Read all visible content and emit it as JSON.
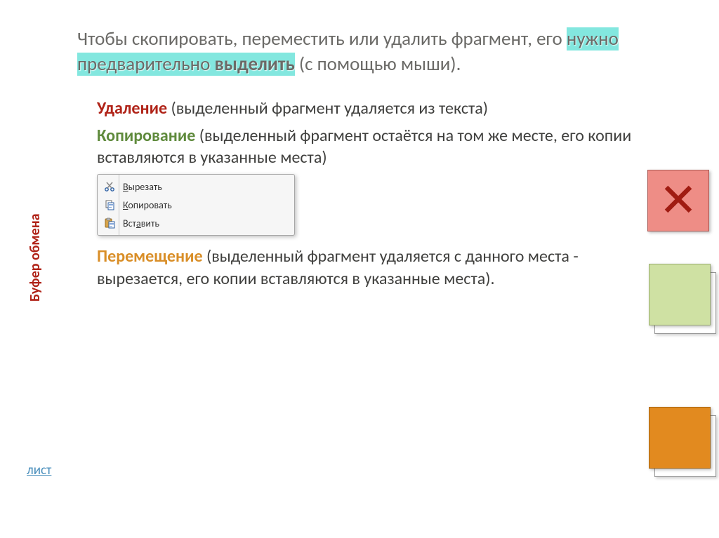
{
  "title": {
    "part1": "Чтобы скопировать, переместить или удалить фрагмент, его ",
    "highlight_pre": "нужно предварительно ",
    "highlight_bold": "выделить",
    "part2": " (с помощью мыши)."
  },
  "sections": {
    "delete": {
      "keyword": "Удаление",
      "text": " (выделенный фрагмент удаляется из текста)"
    },
    "copy": {
      "keyword": "Копирование",
      "text": " (выделенный фрагмент остаётся на том же месте,  его копии вставляются в указанные места)"
    },
    "move": {
      "keyword": "Перемещение",
      "text": " (выделенный фрагмент удаляется с данного места -  вырезается, его копии вставляются в указанные места)."
    }
  },
  "context_menu": {
    "cut": {
      "u": "В",
      "rest": "ырезать"
    },
    "copy": {
      "u": "К",
      "rest": "опировать"
    },
    "paste": {
      "pre": "Вст",
      "u": "а",
      "rest": "вить"
    }
  },
  "sidebar": {
    "clipboard_label": "Буфер обмена",
    "link": "лист"
  },
  "icons": {
    "x_mark": "✕"
  }
}
